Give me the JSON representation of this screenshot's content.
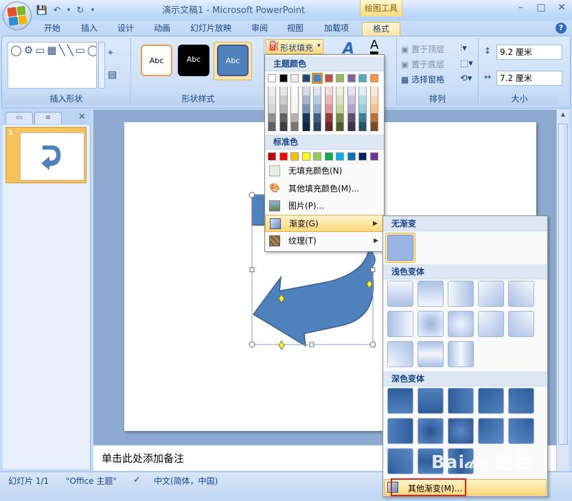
{
  "window": {
    "title": "演示文稿1 - Microsoft PowerPoint",
    "context_tab": "绘图工具",
    "controls": [
      "–",
      "□",
      "✕"
    ]
  },
  "quick_access": {
    "save": "💾",
    "undo": "↶",
    "undo_dropdown": "▾",
    "redo": "↻",
    "customize": "▾"
  },
  "tabs": [
    "开始",
    "插入",
    "设计",
    "动画",
    "幻灯片放映",
    "审阅",
    "视图",
    "加载项",
    "格式"
  ],
  "active_tab": "格式",
  "ribbon": {
    "insert_shapes": {
      "label": "插入形状",
      "gallery": "◯⚙▭▦╲╲▭◯▭△⌐⌐◻◯☐◯╲╱⇨⇩⌂⇧⌒⌒"
    },
    "shape_styles": {
      "label": "形状样式",
      "thumbs": [
        "Abc",
        "Abc",
        "Abc"
      ]
    },
    "fill_button": "形状填充",
    "art_styles": {
      "text_a": "A",
      "font_color_a": "A"
    },
    "arrange": {
      "label": "排列",
      "bring_front": "置于顶层",
      "send_back": "置于底层",
      "selection_pane": "选择窗格"
    },
    "size": {
      "label": "大小",
      "height": "9.2 厘米",
      "width": "7.2 厘米"
    }
  },
  "fill_menu": {
    "theme_header": "主题颜色",
    "standard_header": "标准色",
    "theme_colors": [
      "#ffffff",
      "#000000",
      "#eeece1",
      "#1f497d",
      "#4f81bd",
      "#c0504d",
      "#9bbb59",
      "#8064a2",
      "#4bacc6",
      "#f79646"
    ],
    "standard_colors": [
      "#c00000",
      "#ff0000",
      "#ffc000",
      "#ffff00",
      "#92d050",
      "#00b050",
      "#00b0f0",
      "#0070c0",
      "#002060",
      "#7030a0"
    ],
    "no_fill": "无填充颜色(N)",
    "more_colors": "其他填充颜色(M)...",
    "picture": "图片(P)...",
    "gradient": "渐变(G)",
    "texture": "纹理(T)"
  },
  "gradient_menu": {
    "no_gradient": "无渐变",
    "light_variations": "浅色变体",
    "dark_variations": "深色变体",
    "more_gradients": "其他渐变(M)..."
  },
  "slides_pane": {
    "slide_number": "1"
  },
  "notes_placeholder": "单击此处添加备注",
  "status": {
    "slide": "幻灯片 1/1",
    "theme": "\"Office 主题\"",
    "language": "中文(简体，中国)"
  },
  "watermark": "Baidu 经验"
}
